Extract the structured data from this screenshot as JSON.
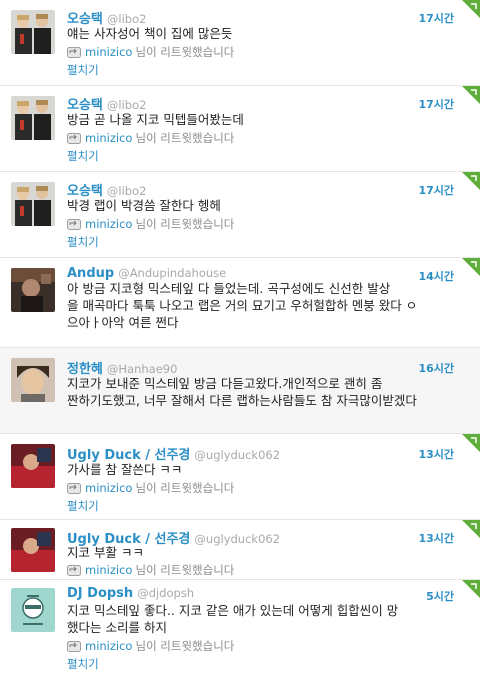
{
  "tweets": [
    {
      "name": "오승택",
      "handle": "@libo2",
      "time": "17시간",
      "text": [
        "얘는 사자성어 책이 집에 많은듯"
      ],
      "retweeter": "minizico",
      "retweet_suffix": "님이 리트윗했습니다",
      "expand": "펼치기",
      "avatar": "duo-portrait"
    },
    {
      "name": "오승택",
      "handle": "@libo2",
      "time": "17시간",
      "text": [
        "방금 곧 나올 지코 믹텝들어봤는데"
      ],
      "retweeter": "minizico",
      "retweet_suffix": "님이 리트윗했습니다",
      "expand": "펼치기",
      "avatar": "duo-portrait"
    },
    {
      "name": "오승택",
      "handle": "@libo2",
      "time": "17시간",
      "text": [
        "박경 랩이 박경씀 잘한다 헹헤"
      ],
      "retweeter": "minizico",
      "retweet_suffix": "님이 리트윗했습니다",
      "expand": "펼치기",
      "avatar": "duo-portrait"
    },
    {
      "name": "Andup",
      "handle": "@Andupindahouse",
      "time": "14시간",
      "text": [
        "아 방금 지코형 믹스테잎 다 들었는데. 곡구성에도 신선한 발상",
        "을 매곡마다 툭툭 나오고 랩은 거의 묘기고 우허헐합하 멘붕 왔다 ㅇ",
        "으아ㅏ아악 여른 쩐다"
      ],
      "avatar": "dark-photo"
    },
    {
      "name": "정한혜",
      "handle": "@Hanhae90",
      "time": "16시간",
      "text": [
        "지코가 보내준 믹스테잎 방금 다듣고왔다.개인적으로 괜히 좀",
        "짠하기도했고, 너무 잘해서 다른 랩하는사람들도 참 자극많이받겠다"
      ],
      "avatar": "face-photo",
      "highlighted": true
    },
    {
      "name": "Ugly Duck / 선주경",
      "handle": "@uglyduck062",
      "time": "13시간",
      "text": [
        "가사를 참 잘쓴다 ㅋㅋ"
      ],
      "retweeter": "minizico",
      "retweet_suffix": "님이 리트윗했습니다",
      "expand": "펼치기",
      "avatar": "red-photo"
    },
    {
      "name": "Ugly Duck / 선주경",
      "handle": "@uglyduck062",
      "time": "13시간",
      "text": [
        "지코 부활 ㅋㅋ"
      ],
      "retweeter": "minizico",
      "retweet_suffix": "님이 리트윗했습니다",
      "expand": "펼치기",
      "avatar": "red-photo"
    },
    {
      "name": "DJ Dopsh",
      "handle": "@djdopsh",
      "time": "5시간",
      "text": [
        "지코 믹스테잎 좋다.. 지코 같은 애가 있는데 어떻게 힙합씬이 망",
        "했다는 소리를 하지"
      ],
      "retweeter": "minizico",
      "retweet_suffix": "님이 리트윗했습니다",
      "expand": "펼치기",
      "avatar": "cartoon"
    }
  ],
  "colors": {
    "link": "#2b8fc6",
    "corner": "#5fae3b",
    "muted": "#a9a9a9"
  }
}
